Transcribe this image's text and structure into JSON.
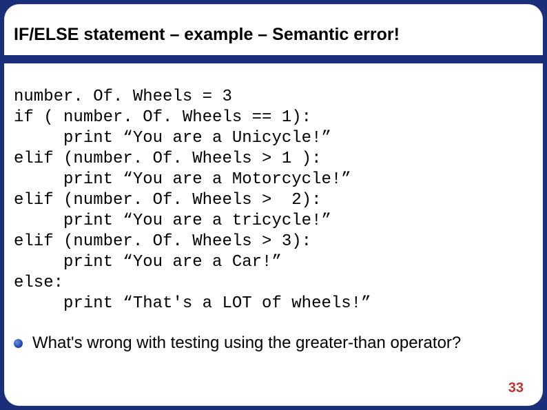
{
  "slide": {
    "title": "IF/ELSE statement – example – Semantic error!",
    "code": "number. Of. Wheels = 3\nif ( number. Of. Wheels == 1):\n     print “You are a Unicycle!”\nelif (number. Of. Wheels > 1 ):\n     print “You are a Motorcycle!”\nelif (number. Of. Wheels >  2):\n     print “You are a tricycle!”\nelif (number. Of. Wheels > 3):\n     print “You are a Car!”\nelse:\n     print “That's a LOT of wheels!”",
    "question": "What's wrong with testing using the greater-than operator?",
    "page_number": "33"
  }
}
